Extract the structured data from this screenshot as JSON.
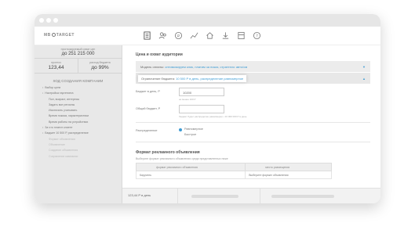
{
  "app": {
    "logo_text_left": "MB",
    "logo_text_right": "TARGET"
  },
  "nav_icons": [
    "document-icon",
    "users-icon",
    "coin-icon",
    "chart-icon",
    "home-icon",
    "download-icon",
    "calculator-icon",
    "help-icon"
  ],
  "sidebar": {
    "budget_label": "прогнозируемый охват цен",
    "budget_value": "до 251 215 000",
    "stat_left_label": "прогноз",
    "stat_left_value": "123,44",
    "stat_right_label": "расход бюджета",
    "stat_right_value": "до 99%",
    "progress_title": "ХОД СОЗДАНИЯ КОМПАНИИ",
    "steps": [
      {
        "label": "Выбор цели",
        "level": 0,
        "muted": false
      },
      {
        "label": "Настройка таргетинга",
        "level": 0,
        "muted": false
      },
      {
        "label": "Пол, возраст, интересы",
        "level": 1,
        "muted": false
      },
      {
        "label": "Задать все регионы",
        "level": 1,
        "muted": false
      },
      {
        "label": "Исключить учитывать",
        "level": 1,
        "muted": false
      },
      {
        "label": "Время показа, характеристики",
        "level": 1,
        "muted": false
      },
      {
        "label": "Время работы на устройствах",
        "level": 1,
        "muted": false
      },
      {
        "label": "За что платит клиент",
        "level": 0,
        "muted": false
      },
      {
        "label": "Бюджет 10 500 Р, распределение",
        "level": 0,
        "muted": false
      },
      {
        "label": "Формат объявления",
        "level": 1,
        "muted": true
      },
      {
        "label": "Объявление",
        "level": 1,
        "muted": true
      },
      {
        "label": "Создание объявления",
        "level": 1,
        "muted": true
      },
      {
        "label": "Сохранение кампании",
        "level": 1,
        "muted": true
      }
    ]
  },
  "main": {
    "section_title": "Цена и охват аудитории",
    "payment_model_label": "Модель оплаты:",
    "payment_model_value": "оптимизируем клик, платим за показ, стратегия: авто/ом",
    "budget_limit_label": "Ограничение бюджета:",
    "budget_limit_value": "10 500 Р в день, распределение равномерное",
    "daily_budget_label": "Бюджет в день, Р",
    "daily_budget_value": "10200",
    "daily_budget_hint": "не менее 100 Р",
    "total_budget_label": "Общий бюджет, Р",
    "total_budget_value": "",
    "total_budget_hint": "бюджет будет распределен равномерно • 10 000 000 Р в день",
    "distribution_label": "Распределение",
    "distribution_options": [
      "Равномерное",
      "Быстрое"
    ],
    "section2_title": "Формат рекламного объявления",
    "section2_desc": "Выберите формат рекламного объявления среди представленных ниже",
    "table_headers": [
      "формат рекламного объявления",
      "место размещения"
    ],
    "table_rows": [
      [
        "Карусель",
        "Выберите формат объявления"
      ]
    ]
  },
  "bottombar": {
    "value": "123,44",
    "unit": "Р в день"
  }
}
